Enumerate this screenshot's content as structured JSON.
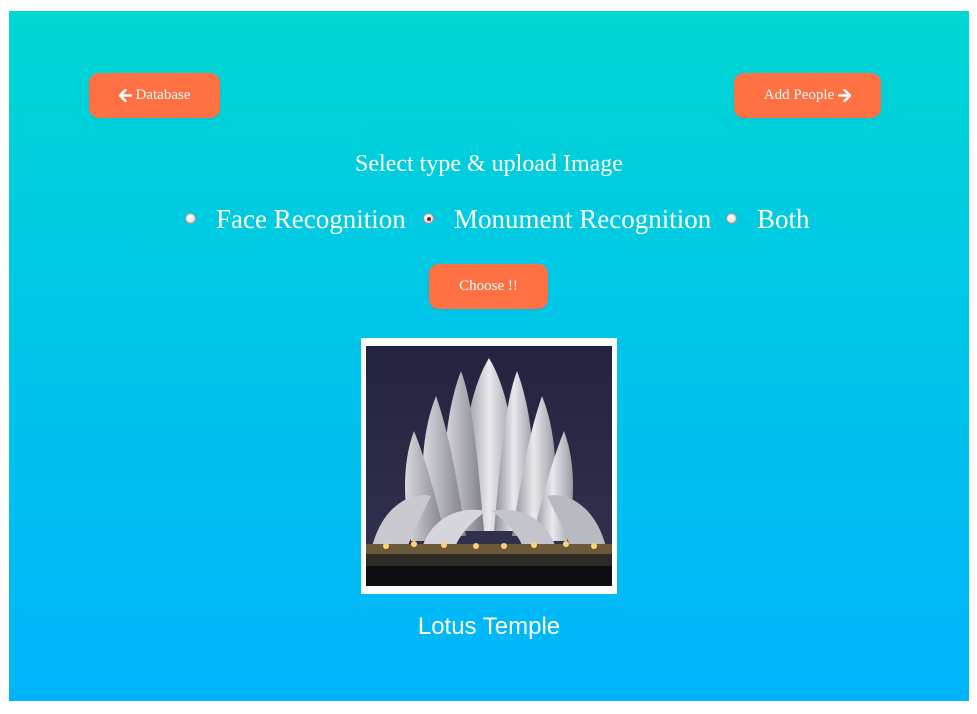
{
  "nav": {
    "back_label": "Database",
    "forward_label": "Add People"
  },
  "heading": "Select type & upload Image",
  "options": [
    {
      "label": "Face Recognition",
      "selected": false
    },
    {
      "label": "Monument Recognition",
      "selected": true
    },
    {
      "label": "Both",
      "selected": false
    }
  ],
  "choose_label": "Choose !!",
  "result": {
    "image_subject": "Lotus Temple photo",
    "caption": "Lotus Temple"
  },
  "colors": {
    "button": "#ff7043",
    "background_top": "#00d6d2",
    "background_bottom": "#00b4fb",
    "text": "#ffffff"
  },
  "icons": {
    "back": "arrow-left-icon",
    "forward": "arrow-right-icon"
  }
}
